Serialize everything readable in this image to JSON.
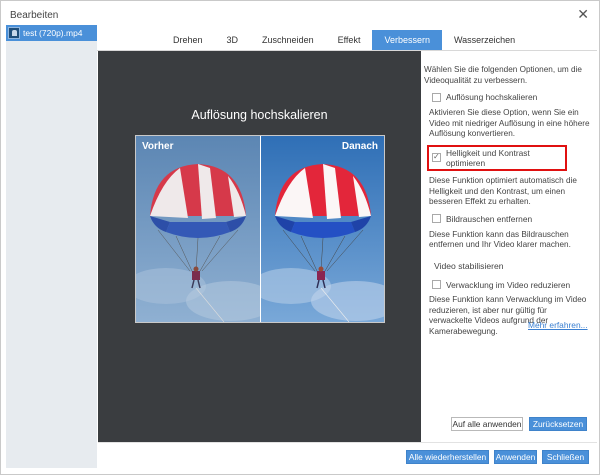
{
  "window": {
    "title": "Bearbeiten"
  },
  "sidebar": {
    "file_name": "test (720p).mp4"
  },
  "tabs": [
    "Drehen",
    "3D",
    "Zuschneiden",
    "Effekt",
    "Verbessern",
    "Wasserzeichen"
  ],
  "active_tab": "Verbessern",
  "preview": {
    "title": "Auflösung hochskalieren",
    "before_label": "Vorher",
    "after_label": "Danach"
  },
  "panel": {
    "intro": "Wählen Sie die folgenden Optionen, um die Videoqualität zu verbessern.",
    "options": [
      {
        "label": "Auflösung hochskalieren",
        "checked": false,
        "description": "Aktivieren Sie diese Option, wenn Sie ein Video mit niedriger Auflösung in eine höhere Auflösung konvertieren."
      },
      {
        "label": "Helligkeit und Kontrast optimieren",
        "checked": true,
        "highlighted": true,
        "description": "Diese Funktion optimiert automatisch die Helligkeit und den Kontrast, um einen besseren Effekt zu erhalten."
      },
      {
        "label": "Bildrauschen entfernen",
        "checked": false,
        "description": "Diese Funktion kann das Bildrauschen entfernen und Ihr Video klarer machen."
      }
    ],
    "stabilize_heading": "Video stabilisieren",
    "stabilize_option": {
      "label": "Verwacklung im Video reduzieren",
      "checked": false,
      "description": "Diese Funktion kann Verwacklung im Video reduzieren, ist aber nur gültig für verwackelte Videos aufgrund der Kamerabewegung."
    },
    "more_link": "Mehr erfahren...",
    "apply_all": "Auf alle anwenden",
    "reset": "Zurücksetzen"
  },
  "footer": {
    "restore_all": "Alle wiederherstellen",
    "apply": "Anwenden",
    "close": "Schließen"
  },
  "colors": {
    "accent": "#4a90d9",
    "highlight_border": "#e01010",
    "preview_bg": "#3a3d40",
    "sidebar_bg": "#e7ebef"
  }
}
